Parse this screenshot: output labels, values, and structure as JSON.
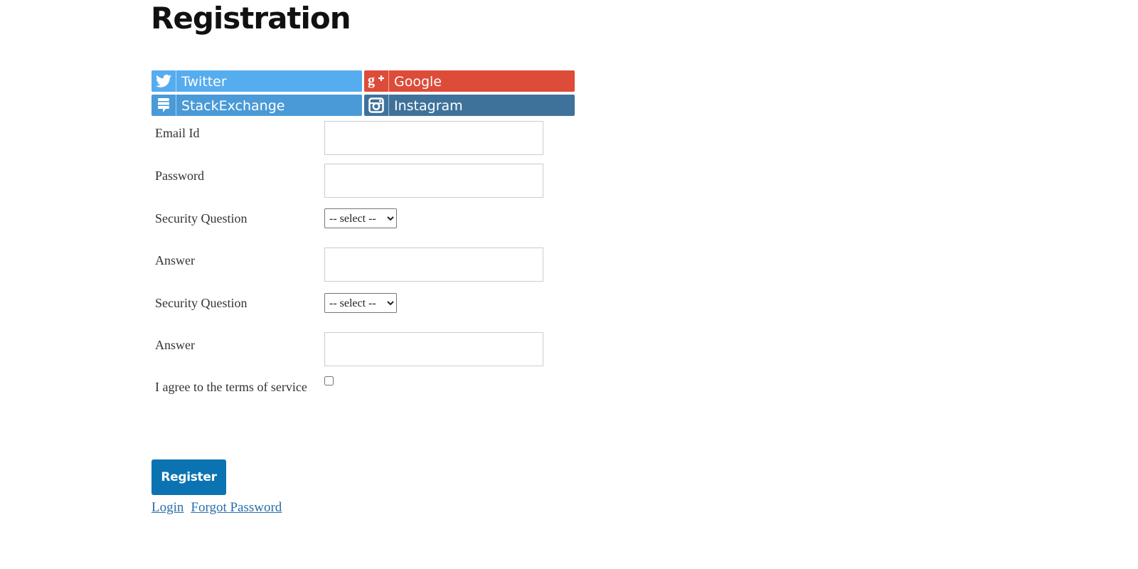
{
  "page": {
    "title": "Registration"
  },
  "social": {
    "twitter": {
      "label": "Twitter",
      "icon": "twitter-icon",
      "color": "#55acee"
    },
    "google": {
      "label": "Google",
      "icon": "google-plus-icon",
      "color": "#dd4b39"
    },
    "stackexchange": {
      "label": "StackExchange",
      "icon": "stackexchange-icon",
      "color": "#4a9ad8"
    },
    "instagram": {
      "label": "Instagram",
      "icon": "instagram-icon",
      "color": "#3f729b"
    }
  },
  "form": {
    "email": {
      "label": "Email Id",
      "value": "",
      "placeholder": ""
    },
    "password": {
      "label": "Password",
      "value": "",
      "placeholder": ""
    },
    "question1": {
      "label": "Security Question",
      "selected": "-- select --"
    },
    "answer1": {
      "label": "Answer",
      "value": "",
      "placeholder": ""
    },
    "question2": {
      "label": "Security Question",
      "selected": "-- select --"
    },
    "answer2": {
      "label": "Answer",
      "value": "",
      "placeholder": ""
    },
    "terms": {
      "label": "I agree to the terms of service",
      "checked": false
    }
  },
  "actions": {
    "register_label": "Register",
    "register_color": "#0b73b1",
    "login_label": "Login",
    "forgot_label": "Forgot Password",
    "link_color": "#2a6ea8"
  }
}
